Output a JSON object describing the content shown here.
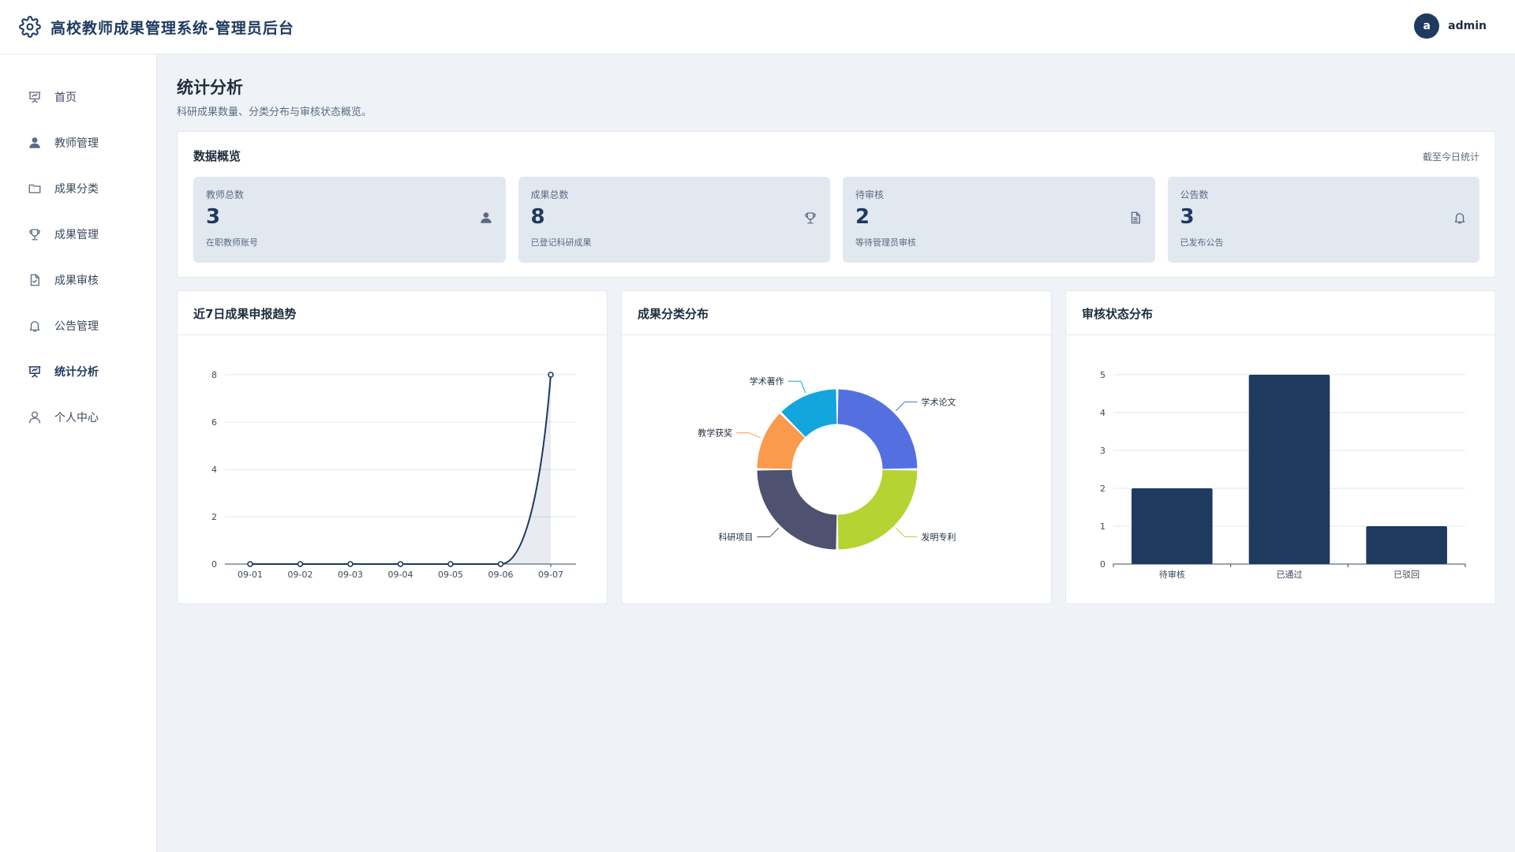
{
  "header": {
    "app_title": "高校教师成果管理系统-管理员后台",
    "avatar_letter": "a",
    "user_name": "admin",
    "logo_icon": "gear-icon"
  },
  "sidebar": {
    "items": [
      {
        "label": "首页",
        "icon": "presentation-chart-icon",
        "active": false
      },
      {
        "label": "教师管理",
        "icon": "user-icon",
        "active": false
      },
      {
        "label": "成果分类",
        "icon": "folder-icon",
        "active": false
      },
      {
        "label": "成果管理",
        "icon": "trophy-icon",
        "active": false
      },
      {
        "label": "成果审核",
        "icon": "file-check-icon",
        "active": false
      },
      {
        "label": "公告管理",
        "icon": "bell-icon",
        "active": false
      },
      {
        "label": "统计分析",
        "icon": "presentation-chart-icon",
        "active": true
      },
      {
        "label": "个人中心",
        "icon": "user-outline-icon",
        "active": false
      }
    ]
  },
  "page": {
    "title": "统计分析",
    "subtitle": "科研成果数量、分类分布与审核状态概览。"
  },
  "overview": {
    "title": "数据概览",
    "note": "截至今日统计",
    "stats": [
      {
        "label": "教师总数",
        "value": "3",
        "desc": "在职教师账号",
        "icon": "user-icon"
      },
      {
        "label": "成果总数",
        "value": "8",
        "desc": "已登记科研成果",
        "icon": "trophy-icon"
      },
      {
        "label": "待审核",
        "value": "2",
        "desc": "等待管理员审核",
        "icon": "document-icon"
      },
      {
        "label": "公告数",
        "value": "3",
        "desc": "已发布公告",
        "icon": "bell-icon"
      }
    ]
  },
  "cards": {
    "trend_title": "近7日成果申报趋势",
    "category_title": "成果分类分布",
    "status_title": "审核状态分布"
  },
  "colors": {
    "primary": "#1e3a5f",
    "background": "#eff3f8",
    "stat_bg": "#e2e8f0"
  },
  "chart_data": [
    {
      "type": "line",
      "title": "",
      "x": [
        "09-01",
        "09-02",
        "09-03",
        "09-04",
        "09-05",
        "09-06",
        "09-07"
      ],
      "series": [
        {
          "values": [
            0,
            0,
            0,
            0,
            0,
            0,
            8
          ]
        }
      ],
      "ylim": [
        0,
        8
      ],
      "yticks": [
        0,
        2,
        4,
        6,
        8
      ],
      "grid": true,
      "color": "#1e3a5f"
    },
    {
      "type": "pie",
      "title": "",
      "donut": true,
      "slices": [
        {
          "label": "学术论文",
          "value": 2,
          "color": "#5470e0"
        },
        {
          "label": "发明专利",
          "value": 2,
          "color": "#b5d433"
        },
        {
          "label": "科研项目",
          "value": 2,
          "color": "#4e5270"
        },
        {
          "label": "教学获奖",
          "value": 1,
          "color": "#f99a4c"
        },
        {
          "label": "学术著作",
          "value": 1,
          "color": "#12a6dc"
        }
      ]
    },
    {
      "type": "bar",
      "title": "",
      "categories": [
        "待审核",
        "已通过",
        "已驳回"
      ],
      "values": [
        2,
        5,
        1
      ],
      "ylim": [
        0,
        5
      ],
      "yticks": [
        0,
        1,
        2,
        3,
        4,
        5
      ],
      "grid": true,
      "color": "#1e3a5f"
    }
  ]
}
